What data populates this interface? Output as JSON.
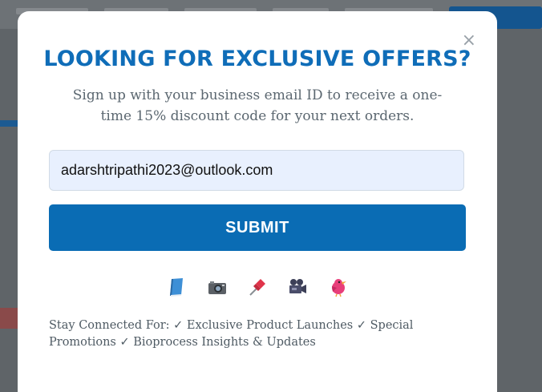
{
  "modal": {
    "close_symbol": "×",
    "title": "LOOKING FOR EXCLUSIVE OFFERS?",
    "subtitle": "Sign up with your business email ID to receive a one-time 15% discount code for your next orders.",
    "email_value": "adarshtripathi2023@outlook.com",
    "submit_label": "SUBMIT",
    "icons": [
      "book-icon",
      "camera-icon",
      "pushpin-icon",
      "movie-camera-icon",
      "bird-icon"
    ],
    "footer_text": "Stay Connected For: ✓ Exclusive Product Launches ✓ Special Promotions ✓ Bioprocess Insights & Updates"
  },
  "colors": {
    "accent": "#0a6cb4",
    "title": "#0f6db8",
    "input_bg": "#e8f0fe",
    "overlay": "#5f6468"
  }
}
